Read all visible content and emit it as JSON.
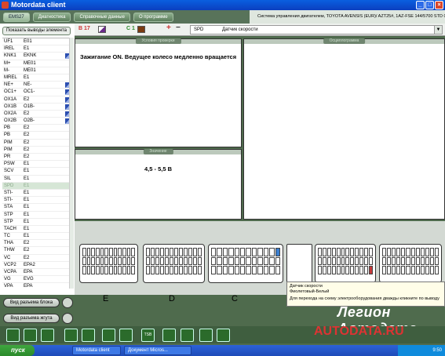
{
  "window": {
    "title": "Motordata client"
  },
  "menu": {
    "tabs": [
      "EMS27",
      "Диагностика",
      "Справочные данные",
      "О программе"
    ]
  },
  "sysinfo": "Система управления двигателем, TOYOTA AVENSIS (EUR)/ AZT25#, 1AZ-FSE 144/5700 STD 07.2003-",
  "left": {
    "show_button": "Показать выводы элемента",
    "elements": [
      {
        "name": "UF1",
        "pin": "E01",
        "icon": false
      },
      {
        "name": "IREL",
        "pin": "E1",
        "icon": false
      },
      {
        "name": "KNK1",
        "pin": "EKNK",
        "icon": true
      },
      {
        "name": "M+",
        "pin": "ME01",
        "icon": false
      },
      {
        "name": "M-",
        "pin": "ME01",
        "icon": false
      },
      {
        "name": "MREL",
        "pin": "E1",
        "icon": false
      },
      {
        "name": "NE+",
        "pin": "NE-",
        "icon": true
      },
      {
        "name": "OC1+",
        "pin": "OC1-",
        "icon": true
      },
      {
        "name": "OX1A",
        "pin": "E2",
        "icon": true
      },
      {
        "name": "OX1B",
        "pin": "O1B-",
        "icon": true
      },
      {
        "name": "OX2A",
        "pin": "E2",
        "icon": true
      },
      {
        "name": "OX2B",
        "pin": "O2B-",
        "icon": true
      },
      {
        "name": "PB",
        "pin": "E2",
        "icon": false
      },
      {
        "name": "PB",
        "pin": "E2",
        "icon": false
      },
      {
        "name": "PIM",
        "pin": "E2",
        "icon": false
      },
      {
        "name": "PIM",
        "pin": "E2",
        "icon": false
      },
      {
        "name": "PR",
        "pin": "E2",
        "icon": false
      },
      {
        "name": "PSW",
        "pin": "E1",
        "icon": false
      },
      {
        "name": "SCV",
        "pin": "E1",
        "icon": false
      },
      {
        "name": "SIL",
        "pin": "E1",
        "icon": false
      },
      {
        "name": "SPD",
        "pin": "E1",
        "icon": false,
        "selected": true
      },
      {
        "name": "STI-",
        "pin": "E1",
        "icon": false
      },
      {
        "name": "STI-",
        "pin": "E1",
        "icon": false
      },
      {
        "name": "STA",
        "pin": "E1",
        "icon": false
      },
      {
        "name": "STP",
        "pin": "E1",
        "icon": false
      },
      {
        "name": "STP",
        "pin": "E1",
        "icon": false
      },
      {
        "name": "TACH",
        "pin": "E1",
        "icon": false
      },
      {
        "name": "TC",
        "pin": "E1",
        "icon": false
      },
      {
        "name": "THA",
        "pin": "E2",
        "icon": false
      },
      {
        "name": "THW",
        "pin": "E2",
        "icon": false
      },
      {
        "name": "VC",
        "pin": "E2",
        "icon": false
      },
      {
        "name": "VCP2",
        "pin": "EPA2",
        "icon": false
      },
      {
        "name": "VCPA",
        "pin": "EPA",
        "icon": false
      },
      {
        "name": "VG",
        "pin": "EVG",
        "icon": false
      },
      {
        "name": "VPA",
        "pin": "EPA",
        "icon": false
      }
    ],
    "block_button": "Вид разъема блока",
    "harness_button": "Вид разъема жгута"
  },
  "toolbar": {
    "pin1": "B 17",
    "pin2": "C 1",
    "plus": "+",
    "minus": "−",
    "signal": "SPD",
    "signal_name": "Датчик скорости"
  },
  "panels": {
    "conditions_title": "Условия проверки",
    "conditions_text": "Зажигание ON. Ведущее колесо медленно вращается",
    "value_title": "Значение",
    "value_text": "4,5 - 5,5 В",
    "osc_title": "Осциллограмма"
  },
  "connectors": [
    "E",
    "D",
    "C"
  ],
  "tooltip": {
    "line1": "Датчик скорости",
    "line2": "Фиолетовый-Белый",
    "line3": "Для перехода на схему электрооборудования дважды кликните по выводу"
  },
  "bottom_buttons": [
    "",
    "",
    "",
    "",
    "",
    "",
    "",
    "TSB",
    "",
    "",
    "",
    ""
  ],
  "logo": {
    "line1": "Легион Автодата",
    "line2": "AUTODATA.RU"
  },
  "taskbar": {
    "start": "пуск",
    "item1": "Motordata client",
    "item2": "Документ Micros...",
    "clock": "9:50"
  },
  "colors": {
    "accent": "#4f6b4d",
    "selected": "#d6e6d6",
    "pin_highlight": "#3b7fd0"
  }
}
